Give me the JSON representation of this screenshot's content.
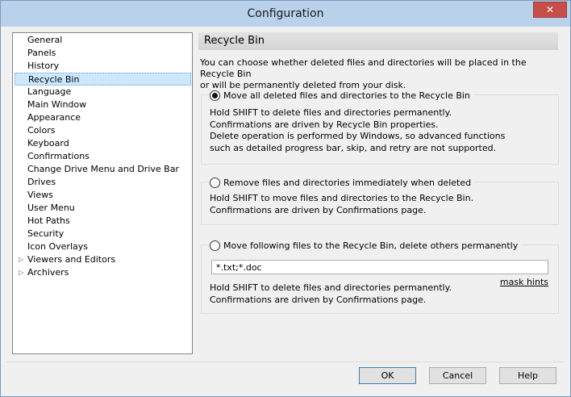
{
  "window": {
    "title": "Configuration",
    "close_glyph": "✕"
  },
  "tree": {
    "items": [
      {
        "label": "General"
      },
      {
        "label": "Panels"
      },
      {
        "label": "History"
      },
      {
        "label": "Recycle Bin",
        "selected": true
      },
      {
        "label": "Language"
      },
      {
        "label": "Main Window"
      },
      {
        "label": "Appearance"
      },
      {
        "label": "Colors"
      },
      {
        "label": "Keyboard"
      },
      {
        "label": "Confirmations"
      },
      {
        "label": "Change Drive Menu and Drive Bar"
      },
      {
        "label": "Drives"
      },
      {
        "label": "Views"
      },
      {
        "label": "User Menu"
      },
      {
        "label": "Hot Paths"
      },
      {
        "label": "Security"
      },
      {
        "label": "Icon Overlays"
      },
      {
        "label": "Viewers and Editors",
        "expandable": true
      },
      {
        "label": "Archivers",
        "expandable": true
      }
    ],
    "expand_glyph": "▷"
  },
  "page": {
    "header": "Recycle Bin",
    "description_1": "You can choose whether deleted files and directories will be placed in the Recycle Bin",
    "description_2": "or will be permanently deleted from your disk."
  },
  "options": {
    "opt1": {
      "label": "Move all deleted files and directories to the Recycle Bin",
      "checked": true,
      "lines": [
        "Hold SHIFT to delete files and directories permanently.",
        "Confirmations are driven by Recycle Bin properties.",
        "Delete operation is performed by Windows, so advanced functions",
        "such as detailed progress bar, skip, and retry are not supported."
      ]
    },
    "opt2": {
      "label": "Remove files and directories immediately when deleted",
      "checked": false,
      "lines": [
        "Hold SHIFT to move files and directories to the Recycle Bin.",
        "Confirmations are driven by Confirmations page."
      ]
    },
    "opt3": {
      "label": "Move following files to the Recycle Bin, delete others permanently",
      "checked": false,
      "mask_value": "*.txt;*.doc",
      "mask_hints": "mask hints",
      "lines": [
        "Hold SHIFT to delete files and directories permanently.",
        "Confirmations are driven by Confirmations page."
      ]
    }
  },
  "buttons": {
    "ok": "OK",
    "cancel": "Cancel",
    "help": "Help"
  },
  "colors": {
    "selection": "#cce8ff",
    "titlebar": "#b9d1ea",
    "close": "#c74f4a"
  }
}
